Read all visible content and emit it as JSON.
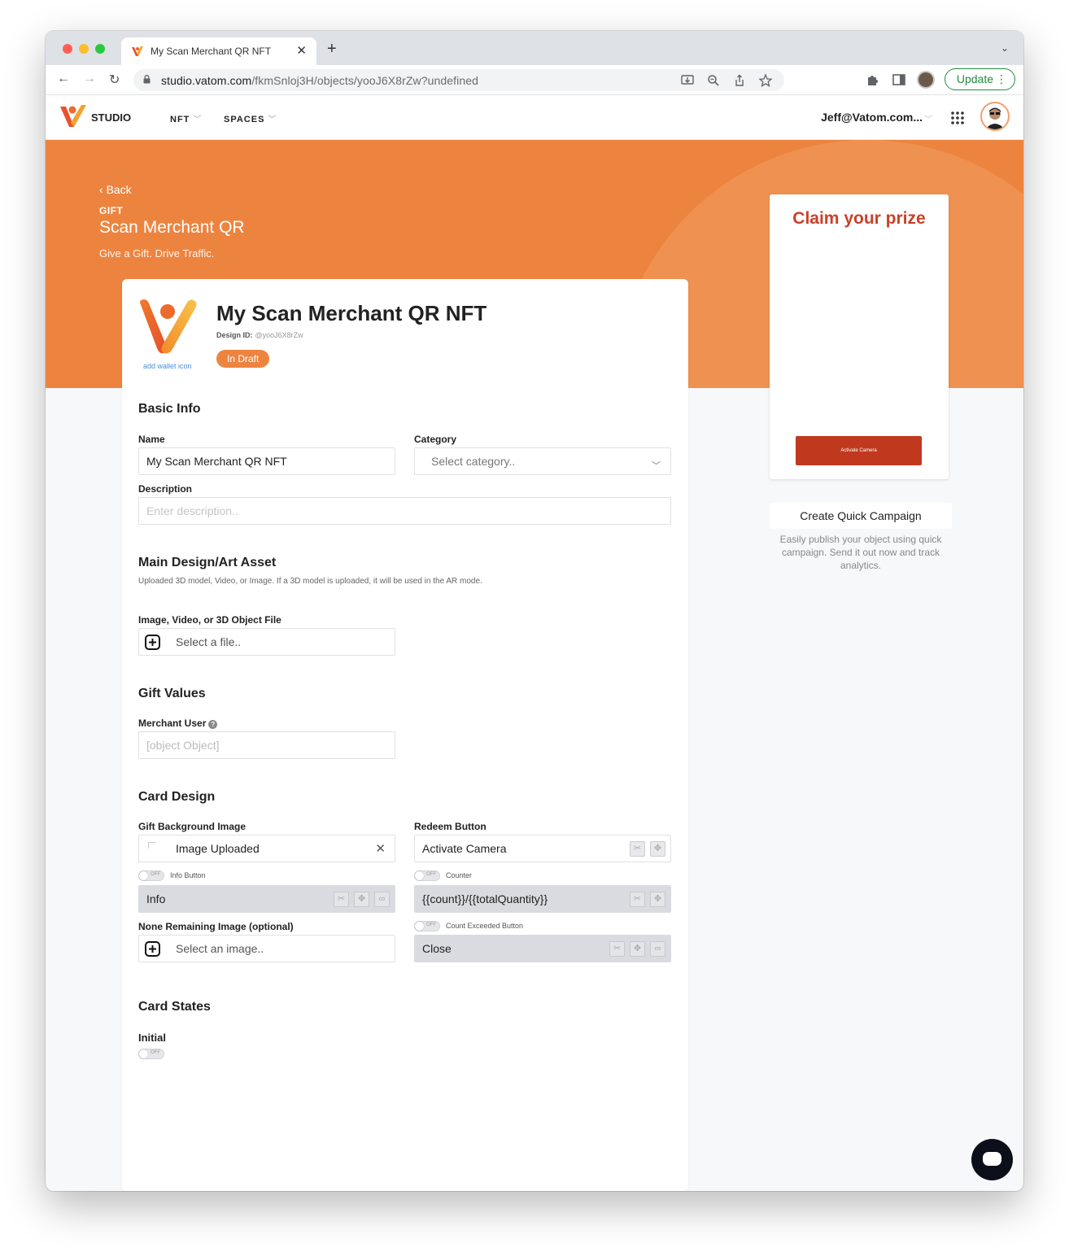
{
  "browser": {
    "tab_title": "My Scan Merchant QR NFT",
    "url_host": "studio.vatom.com",
    "url_path": "/fkmSnloj3H/objects/yooJ6X8rZw?undefined",
    "update_label": "Update"
  },
  "header": {
    "studio_label": "STUDIO",
    "nav": [
      "NFT",
      "SPACES"
    ],
    "user_email": "Jeff@Vatom.com..."
  },
  "hero": {
    "back_label": "Back",
    "kicker": "GIFT",
    "title": "Scan Merchant QR",
    "subtitle": "Give a Gift. Drive Traffic."
  },
  "nft": {
    "name": "My Scan Merchant QR NFT",
    "design_id_label": "Design ID:",
    "design_id": "@yooJ6X8rZw",
    "status": "In Draft",
    "add_wallet_icon": "add wallet icon"
  },
  "basic_info": {
    "title": "Basic Info",
    "name_label": "Name",
    "name_value": "My Scan Merchant QR NFT",
    "category_label": "Category",
    "category_placeholder": "Select category..",
    "description_label": "Description",
    "description_placeholder": "Enter description.."
  },
  "main_design": {
    "title": "Main Design/Art Asset",
    "subtitle": "Uploaded 3D model, Video, or Image. If a 3D model is uploaded, it will be used in the AR mode.",
    "file_label": "Image, Video, or 3D Object File",
    "file_placeholder": "Select a file.."
  },
  "gift_values": {
    "title": "Gift Values",
    "merchant_label": "Merchant User",
    "merchant_placeholder": "[object Object]"
  },
  "card_design": {
    "title": "Card Design",
    "bg_image_label": "Gift Background Image",
    "bg_image_value": "Image Uploaded",
    "info_toggle_label": "Info Button",
    "info_value": "Info",
    "none_remaining_label": "None Remaining Image (optional)",
    "none_remaining_placeholder": "Select an image..",
    "redeem_label": "Redeem Button",
    "redeem_value": "Activate Camera",
    "counter_toggle_label": "Counter",
    "counter_value": "{{count}}/{{totalQuantity}}",
    "exceeded_toggle_label": "Count Exceeded Button",
    "exceeded_value": "Close",
    "toggle_off": "OFF"
  },
  "card_states": {
    "title": "Card States",
    "initial_label": "Initial"
  },
  "preview": {
    "headline": "Claim your prize",
    "button": "Activate Camera",
    "campaign_button": "Create Quick Campaign",
    "campaign_description": "Easily publish your object using quick campaign. Send it out now and track analytics."
  },
  "colors": {
    "brand_orange": "#ec8440",
    "prize_red": "#c8412a",
    "button_red": "#c0391f",
    "update_green": "#1e8e3e"
  }
}
